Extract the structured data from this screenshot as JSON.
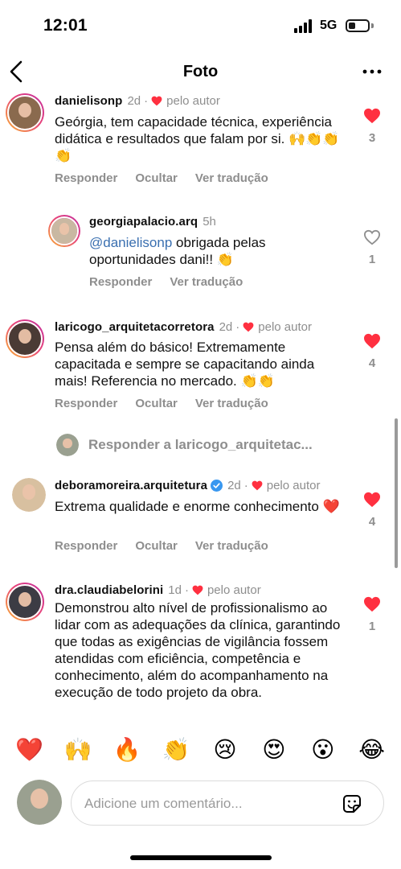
{
  "status_bar": {
    "time": "12:01",
    "network": "5G"
  },
  "header": {
    "title": "Foto"
  },
  "comments": [
    {
      "username": "danielisonp",
      "time": "2d",
      "by_author": "pelo autor",
      "text": "Geórgia, tem capacidade técnica, experiência didática e resultados que falam por si. 🙌👏👏👏",
      "actions": [
        "Responder",
        "Ocultar",
        "Ver tradução"
      ],
      "likes": "3",
      "liked": true
    },
    {
      "username": "georgiapalacio.arq",
      "time": "5h",
      "mention": "@danielisonp",
      "text": " obrigada pelas oportunidades dani!! 👏",
      "actions": [
        "Responder",
        "Ver tradução"
      ],
      "likes": "1",
      "liked": false
    },
    {
      "username": "laricogo_arquitetacorretora",
      "time": "2d",
      "by_author": "pelo autor",
      "text": "Pensa além do básico! Extremamente capacitada e sempre se capacitando ainda mais! Referencia no mercado. 👏👏",
      "actions": [
        "Responder",
        "Ocultar",
        "Ver tradução"
      ],
      "likes": "4",
      "liked": true
    },
    {
      "username": "deboramoreira.arquitetura",
      "time": "2d",
      "by_author": "pelo autor",
      "text": "Extrema qualidade e enorme conhecimento ❤️",
      "actions": [
        "Responder",
        "Ocultar",
        "Ver tradução"
      ],
      "likes": "4",
      "liked": true
    },
    {
      "username": "dra.claudiabelorini",
      "time": "1d",
      "by_author": "pelo autor",
      "text": "Demonstrou alto nível de profissionalismo ao lidar com as adequações da clínica, garantindo que todas as exigências de vigilância fossem atendidas com eficiência, competência e conhecimento, além do acompanhamento na execução de todo projeto da obra.",
      "likes": "1",
      "liked": true
    }
  ],
  "reply_prompt": "Responder a laricogo_arquitetac...",
  "emoji_bar": [
    "❤️",
    "🙌",
    "🔥",
    "👏",
    "😢",
    "😍",
    "😮",
    "😂"
  ],
  "composer": {
    "placeholder": "Adicione um comentário..."
  },
  "colors": {
    "like_red": "#ff3040",
    "muted": "#8e8e8e",
    "mention_blue": "#3a6fb0",
    "verified_blue": "#3897f0"
  }
}
